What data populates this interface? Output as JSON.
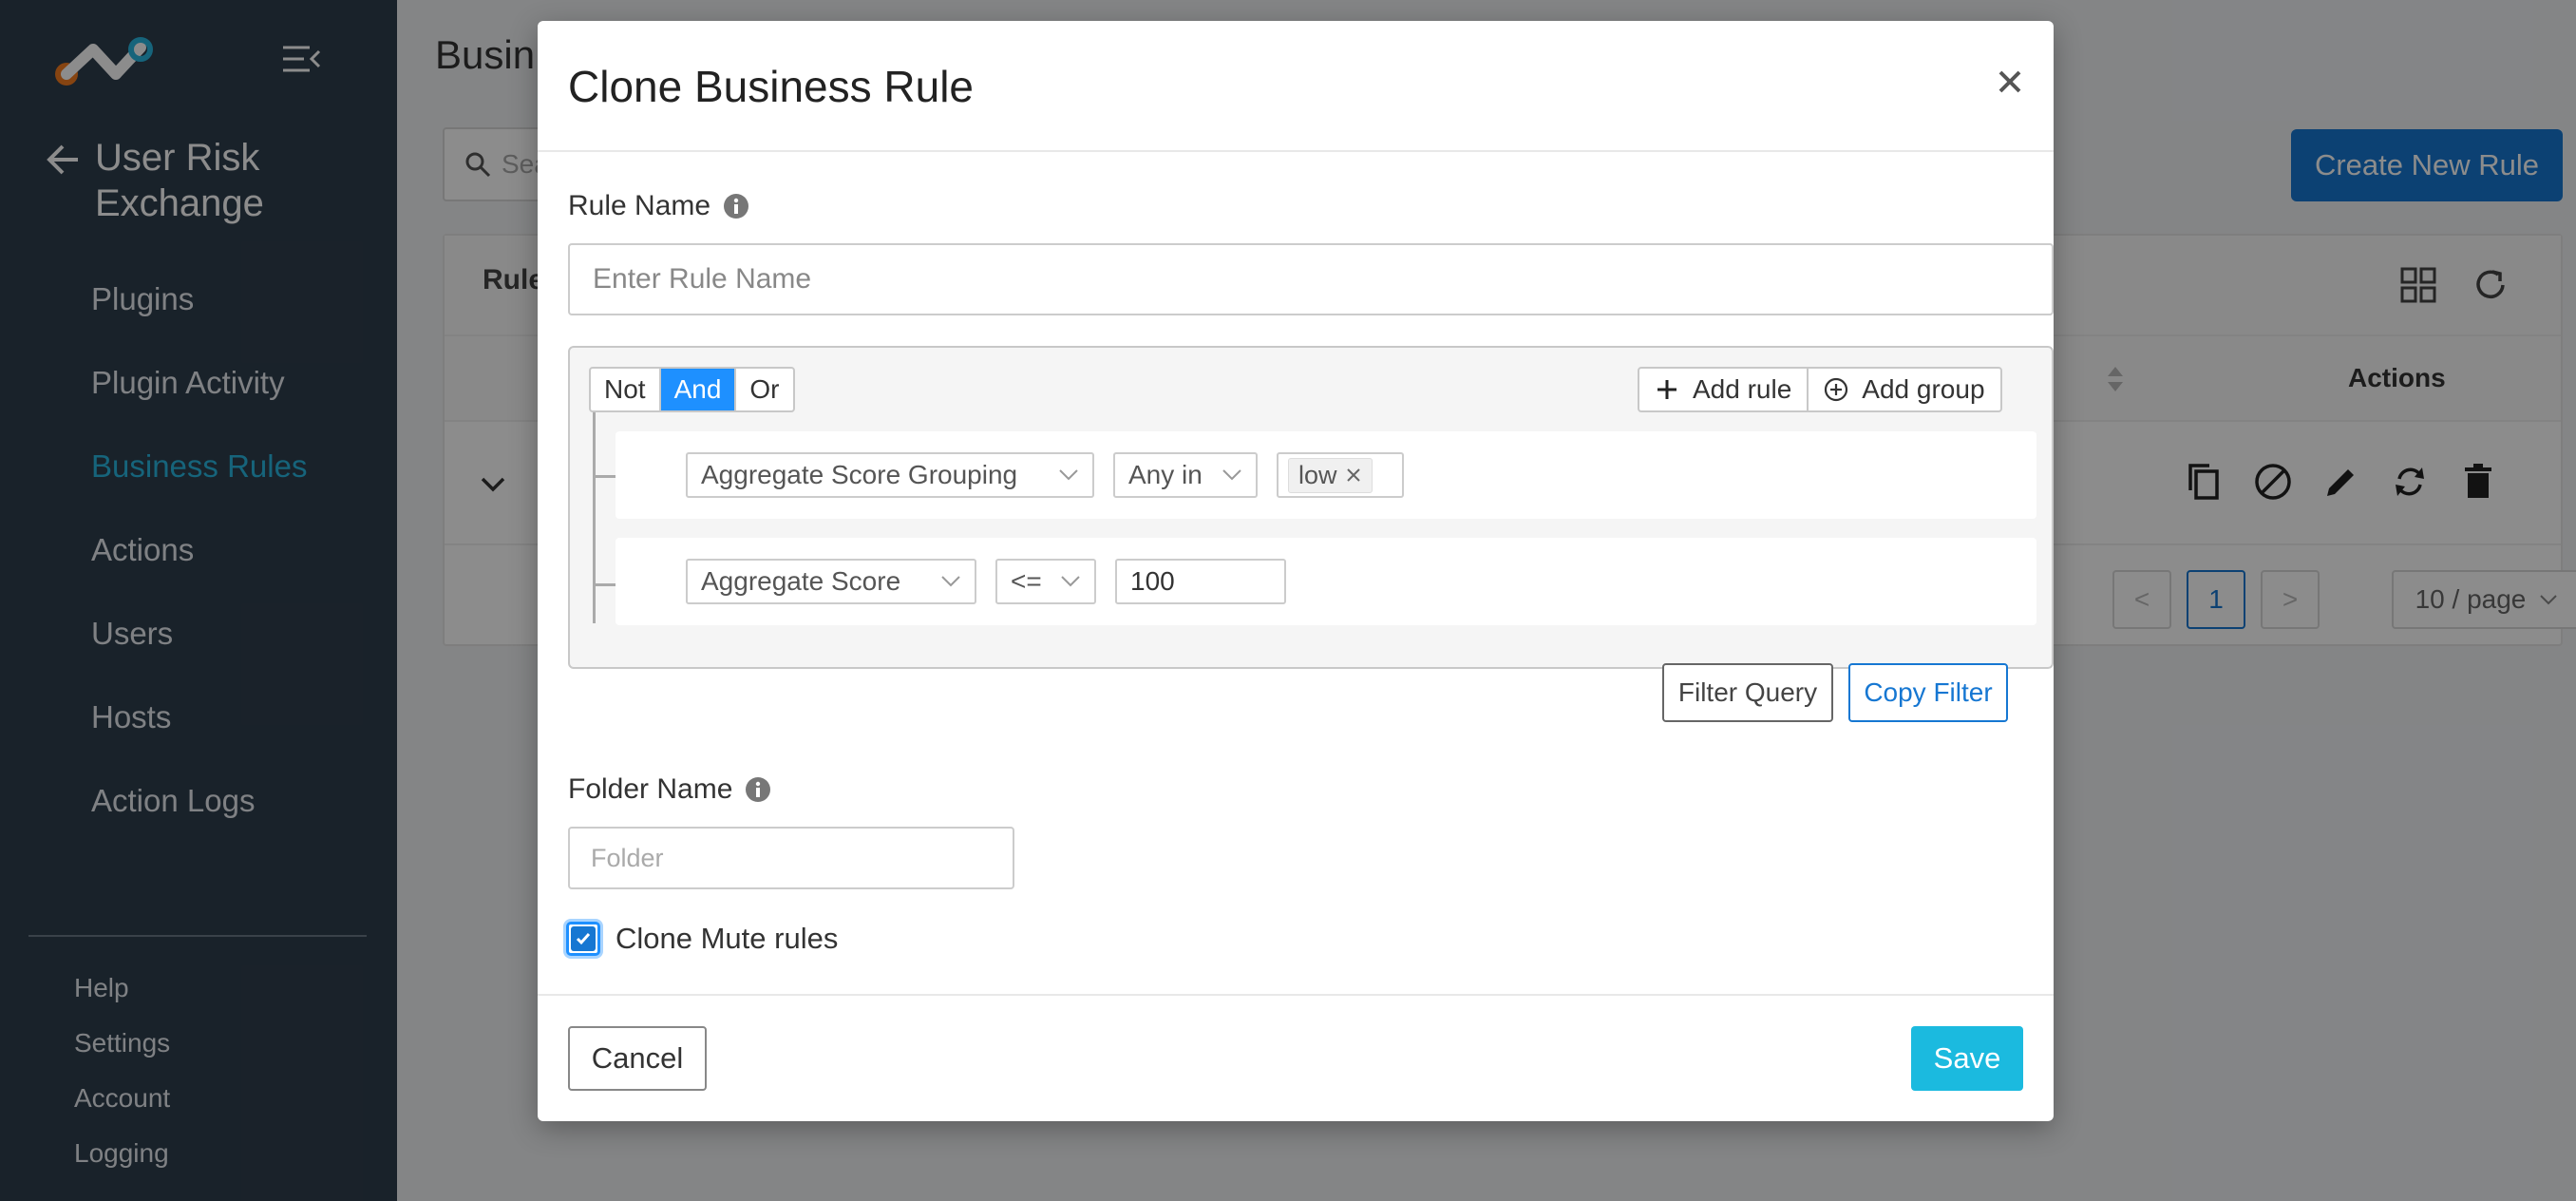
{
  "sidebar": {
    "module_title": "User Risk Exchange",
    "nav_items": [
      {
        "label": "Plugins"
      },
      {
        "label": "Plugin Activity"
      },
      {
        "label": "Business Rules"
      },
      {
        "label": "Actions"
      },
      {
        "label": "Users"
      },
      {
        "label": "Hosts"
      },
      {
        "label": "Action Logs"
      }
    ],
    "active_item": "Business Rules",
    "bottom_items": [
      {
        "label": "Help"
      },
      {
        "label": "Settings"
      },
      {
        "label": "Account"
      },
      {
        "label": "Logging"
      }
    ]
  },
  "page": {
    "title": "Busin",
    "search_placeholder": "Sea",
    "create_button": "Create New Rule",
    "table": {
      "first_header": "Rule",
      "actions_header": "Actions",
      "pagination": {
        "prev": "<",
        "current": "1",
        "next": ">",
        "page_size": "10 / page"
      }
    }
  },
  "modal": {
    "title": "Clone Business Rule",
    "rule_name_label": "Rule Name",
    "rule_name_placeholder": "Enter Rule Name",
    "query": {
      "conjunctions": [
        "Not",
        "And",
        "Or"
      ],
      "active_conjunction": "And",
      "add_rule": "Add rule",
      "add_group": "Add group",
      "rules": [
        {
          "field": "Aggregate Score Grouping",
          "operator": "Any in",
          "value_tag": "low"
        },
        {
          "field": "Aggregate Score",
          "operator": "<=",
          "value": "100"
        }
      ]
    },
    "filter_query_button": "Filter Query",
    "copy_filter_button": "Copy Filter",
    "folder_label": "Folder Name",
    "folder_placeholder": "Folder",
    "clone_mute_label": "Clone Mute rules",
    "clone_mute_checked": true,
    "cancel_button": "Cancel",
    "save_button": "Save"
  },
  "colors": {
    "sidebar_bg": "#2f3e4d",
    "accent_active": "#29b6e0",
    "primary_blue": "#1677d2",
    "save_cyan": "#1bbadf",
    "conj_active": "#1e90ff"
  }
}
